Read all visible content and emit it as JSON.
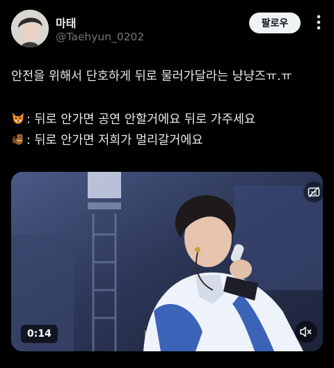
{
  "tweet": {
    "author": {
      "display_name": "마태",
      "handle": "@Taehyun_0202"
    },
    "follow_label": "팔로우",
    "text": {
      "line1": "안전을 위해서 단호하게 뒤로 물러가달라는 냥냥즈ㅠ.ㅠ",
      "line2": ": 뒤로 안가면 공연 안할거에요 뒤로 가주세요",
      "line3": ": 뒤로 안가면 저희가 멀리갈거에요",
      "line2_icon": "fox-emoji",
      "line3_icon": "chipmunk-emoji"
    },
    "video": {
      "duration": "0:14",
      "caption_icon": "captions-off-icon",
      "mute_icon": "muted-speaker-icon"
    }
  },
  "colors": {
    "background": "#000000",
    "text_primary": "#e7e9ea",
    "text_secondary": "#71767b",
    "follow_bg": "#eff3f4"
  }
}
